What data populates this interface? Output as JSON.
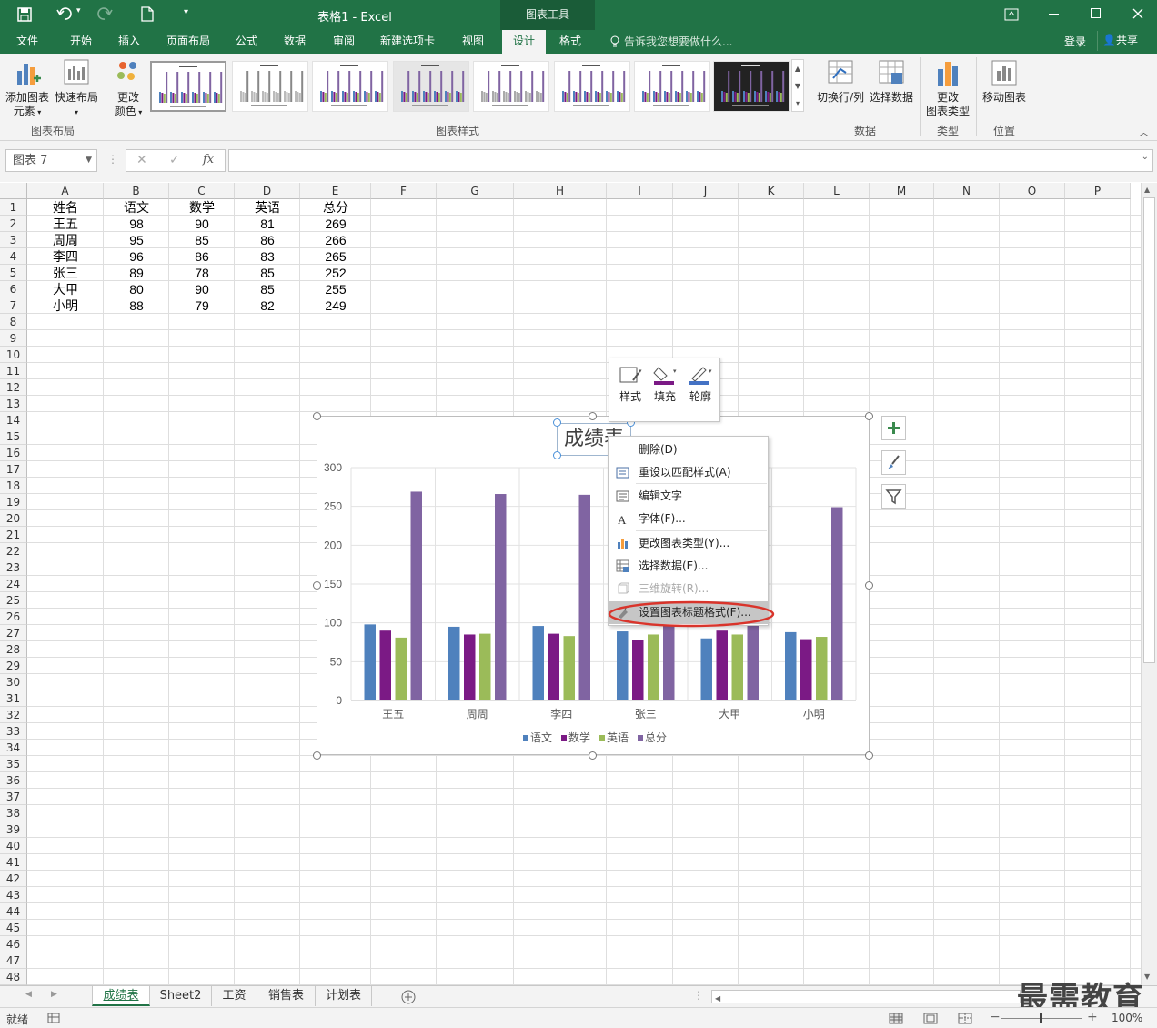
{
  "titlebar": {
    "doc_title": "表格1 - Excel",
    "context_tab": "图表工具"
  },
  "tabs": [
    {
      "label": "文件"
    },
    {
      "label": "开始"
    },
    {
      "label": "插入"
    },
    {
      "label": "页面布局"
    },
    {
      "label": "公式"
    },
    {
      "label": "数据"
    },
    {
      "label": "审阅"
    },
    {
      "label": "新建选项卡"
    },
    {
      "label": "视图"
    },
    {
      "label": "设计"
    },
    {
      "label": "格式"
    }
  ],
  "tellme": "告诉我您想要做什么...",
  "login": "登录",
  "share": "共享",
  "ribbon": {
    "add_element_1": "添加图表",
    "add_element_2": "元素",
    "quick_layout": "快速布局",
    "change_color_1": "更改",
    "change_color_2": "颜色",
    "group_layout": "图表布局",
    "group_styles": "图表样式",
    "switch_rowcol": "切换行/列",
    "select_data": "选择数据",
    "group_data": "数据",
    "change_type_1": "更改",
    "change_type_2": "图表类型",
    "group_type": "类型",
    "move_chart": "移动图表",
    "group_location": "位置"
  },
  "namebox": "图表 7",
  "fx": "fx",
  "columns": [
    "A",
    "B",
    "C",
    "D",
    "E",
    "F",
    "G",
    "H",
    "I",
    "J",
    "K",
    "L",
    "M",
    "N",
    "O",
    "P"
  ],
  "rows": [
    "1",
    "2",
    "3",
    "4",
    "5",
    "6",
    "7",
    "8",
    "9",
    "10",
    "11",
    "12",
    "13",
    "14",
    "15",
    "16",
    "17",
    "18",
    "19",
    "20",
    "21",
    "22",
    "23",
    "24",
    "25",
    "26",
    "27",
    "28",
    "29",
    "30",
    "31",
    "32",
    "33",
    "34",
    "35",
    "36",
    "37",
    "38",
    "39",
    "40",
    "41",
    "42",
    "43",
    "44",
    "45",
    "46",
    "47",
    "48"
  ],
  "table": [
    [
      "姓名",
      "语文",
      "数学",
      "英语",
      "总分"
    ],
    [
      "王五",
      "98",
      "90",
      "81",
      "269"
    ],
    [
      "周周",
      "95",
      "85",
      "86",
      "266"
    ],
    [
      "李四",
      "96",
      "86",
      "83",
      "265"
    ],
    [
      "张三",
      "89",
      "78",
      "85",
      "252"
    ],
    [
      "大甲",
      "80",
      "90",
      "85",
      "255"
    ],
    [
      "小明",
      "88",
      "79",
      "82",
      "249"
    ]
  ],
  "chart_data": {
    "type": "bar",
    "title": "成绩表",
    "categories": [
      "王五",
      "周周",
      "李四",
      "张三",
      "大甲",
      "小明"
    ],
    "series": [
      {
        "name": "语文",
        "color": "#4f81bd",
        "values": [
          98,
          95,
          96,
          89,
          80,
          88
        ]
      },
      {
        "name": "数学",
        "color": "#7b1a85",
        "values": [
          90,
          85,
          86,
          78,
          90,
          79
        ]
      },
      {
        "name": "英语",
        "color": "#9bbb59",
        "values": [
          81,
          86,
          83,
          85,
          85,
          82
        ]
      },
      {
        "name": "总分",
        "color": "#8064a2",
        "values": [
          269,
          266,
          265,
          252,
          255,
          249
        ]
      }
    ],
    "ylim": [
      0,
      300
    ],
    "yticks": [
      0,
      50,
      100,
      150,
      200,
      250,
      300
    ],
    "legend": "bottom",
    "grid": true
  },
  "minitoolbar": {
    "style": "样式",
    "fill": "填充",
    "outline": "轮廓"
  },
  "context_menu": [
    {
      "label": "删除(D)",
      "icon": "none",
      "state": "normal"
    },
    {
      "label": "重设以匹配样式(A)",
      "icon": "reset-style-icon",
      "state": "normal"
    },
    {
      "label": "编辑文字",
      "icon": "edit-text-icon",
      "state": "normal"
    },
    {
      "label": "字体(F)...",
      "icon": "font-icon",
      "state": "normal"
    },
    {
      "label": "更改图表类型(Y)...",
      "icon": "chart-type-icon",
      "state": "normal"
    },
    {
      "label": "选择数据(E)...",
      "icon": "select-data-icon",
      "state": "normal"
    },
    {
      "label": "三维旋转(R)...",
      "icon": "rotate-3d-icon",
      "state": "disabled"
    },
    {
      "label": "设置图表标题格式(F)...",
      "icon": "format-icon",
      "state": "highlighted"
    }
  ],
  "sheets": [
    "成绩表",
    "Sheet2",
    "工资",
    "销售表",
    "计划表"
  ],
  "active_sheet": "成绩表",
  "status": {
    "ready": "就绪",
    "zoom": "100%"
  },
  "watermark": "最需教育",
  "accent": "#217346"
}
